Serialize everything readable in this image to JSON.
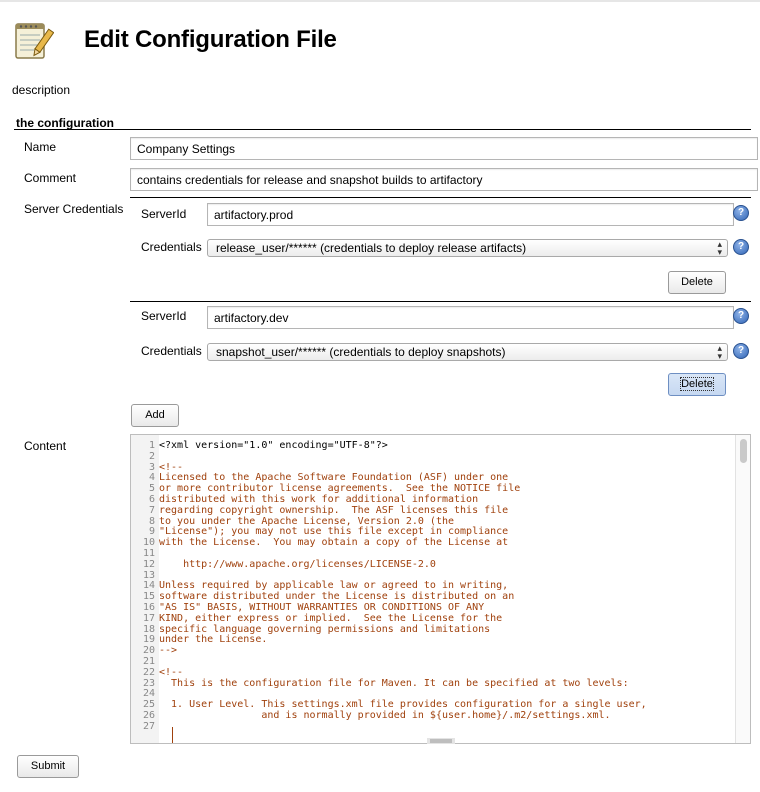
{
  "page": {
    "title": "Edit Configuration File",
    "description_label": "description",
    "section_title": "the configuration"
  },
  "form": {
    "name_label": "Name",
    "name_value": "Company Settings",
    "comment_label": "Comment",
    "comment_value": "contains credentials for release and snapshot builds to artifactory",
    "server_credentials_label": "Server Credentials",
    "servers": [
      {
        "serverid_label": "ServerId",
        "serverid_value": "artifactory.prod",
        "credentials_label": "Credentials",
        "credentials_value": "release_user/****** (credentials to deploy release artifacts)",
        "delete_label": "Delete"
      },
      {
        "serverid_label": "ServerId",
        "serverid_value": "artifactory.dev",
        "credentials_label": "Credentials",
        "credentials_value": "snapshot_user/****** (credentials to deploy snapshots)",
        "delete_label": "Delete"
      }
    ],
    "add_label": "Add",
    "content_label": "Content",
    "submit_label": "Submit"
  },
  "help_glyph": "?",
  "editor": {
    "lines": [
      {
        "n": "1",
        "t": "<?xml version=\"1.0\" encoding=\"UTF-8\"?>",
        "c": false
      },
      {
        "n": "2",
        "t": "",
        "c": false
      },
      {
        "n": "3",
        "t": "<!--",
        "c": true
      },
      {
        "n": "4",
        "t": "Licensed to the Apache Software Foundation (ASF) under one",
        "c": true
      },
      {
        "n": "5",
        "t": "or more contributor license agreements.  See the NOTICE file",
        "c": true
      },
      {
        "n": "6",
        "t": "distributed with this work for additional information",
        "c": true
      },
      {
        "n": "7",
        "t": "regarding copyright ownership.  The ASF licenses this file",
        "c": true
      },
      {
        "n": "8",
        "t": "to you under the Apache License, Version 2.0 (the",
        "c": true
      },
      {
        "n": "9",
        "t": "\"License\"); you may not use this file except in compliance",
        "c": true
      },
      {
        "n": "10",
        "t": "with the License.  You may obtain a copy of the License at",
        "c": true
      },
      {
        "n": "11",
        "t": "",
        "c": true
      },
      {
        "n": "12",
        "t": "    http://www.apache.org/licenses/LICENSE-2.0",
        "c": true
      },
      {
        "n": "13",
        "t": "",
        "c": true
      },
      {
        "n": "14",
        "t": "Unless required by applicable law or agreed to in writing,",
        "c": true
      },
      {
        "n": "15",
        "t": "software distributed under the License is distributed on an",
        "c": true
      },
      {
        "n": "16",
        "t": "\"AS IS\" BASIS, WITHOUT WARRANTIES OR CONDITIONS OF ANY",
        "c": true
      },
      {
        "n": "17",
        "t": "KIND, either express or implied.  See the License for the",
        "c": true
      },
      {
        "n": "18",
        "t": "specific language governing permissions and limitations",
        "c": true
      },
      {
        "n": "19",
        "t": "under the License.",
        "c": true
      },
      {
        "n": "20",
        "t": "-->",
        "c": true
      },
      {
        "n": "21",
        "t": "",
        "c": false
      },
      {
        "n": "22",
        "t": "<!--",
        "c": true
      },
      {
        "n": "23",
        "t": "  This is the configuration file for Maven. It can be specified at two levels:",
        "c": true
      },
      {
        "n": "24",
        "t": "",
        "c": true
      },
      {
        "n": "25",
        "t": "  1. User Level. This settings.xml file provides configuration for a single user,",
        "c": true
      },
      {
        "n": "26",
        "t": "                 and is normally provided in ${user.home}/.m2/settings.xml.",
        "c": true
      },
      {
        "n": "27",
        "t": "",
        "c": true
      }
    ]
  }
}
